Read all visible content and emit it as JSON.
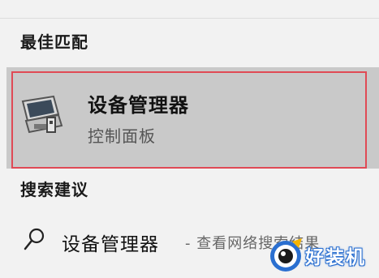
{
  "best_match": {
    "header": "最佳匹配",
    "title": "设备管理器",
    "subtitle": "控制面板",
    "icon": "device-manager-icon"
  },
  "suggestions": {
    "header": "搜索建议",
    "items": [
      {
        "text": "设备管理器",
        "hint": "- 查看网络搜索结果",
        "icon": "search-icon"
      }
    ]
  },
  "watermark": {
    "text": "好装机"
  },
  "colors": {
    "background": "#f2f2f2",
    "selected_row": "#c9c9c9",
    "highlight_border": "#e04a55",
    "watermark_blue": "#2a6fd0"
  }
}
